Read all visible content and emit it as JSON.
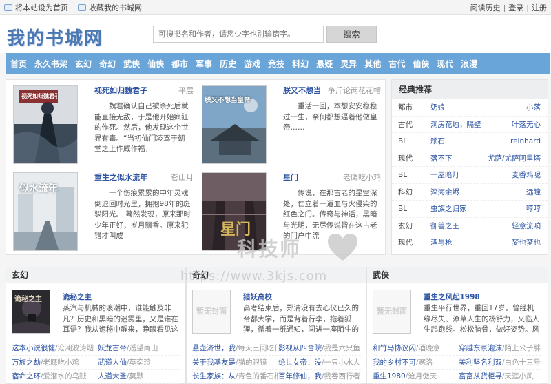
{
  "topbar": {
    "set_home": "将本站设为首页",
    "bookmark": "收藏我的书城网",
    "history": "阅读历史",
    "login": "登录",
    "register": "注册"
  },
  "logo": "我的书城网",
  "search": {
    "placeholder": "可搜书名和作者，请您少字也别输错字。",
    "button": "搜索"
  },
  "nav": [
    "首页",
    "永久书架",
    "玄幻",
    "奇幻",
    "武侠",
    "仙侠",
    "都市",
    "军事",
    "历史",
    "游戏",
    "竞技",
    "科幻",
    "悬疑",
    "灵异",
    "其他",
    "古代",
    "仙侠",
    "现代",
    "浪漫"
  ],
  "featured": [
    {
      "title": "视死如归魏君子",
      "author": "平层",
      "desc": "魏君确认自己被杀死后就能直接无敌，于是他开始疯狂的作死。然后，他发现这个世界有毒。“当初仙门凌驾于朝堂之上作威作福，"
    },
    {
      "title": "朕又不想当",
      "author": "争斤论两花花帽",
      "desc": "重活一回，本想安安稳稳过一生，奈何都想逼着他做皇帝……"
    },
    {
      "title": "重生之似水流年",
      "author": "苍山月",
      "desc": "一个伤痕累累的中年灵魂倒退回时光里，拥抱98年的斑驳阳光。 蓦然发现，原来那时少年正好，岁月飘香。原来犯错才叫成"
    },
    {
      "title": "星门",
      "author": "老鹰吃小鸡",
      "desc": "传说，在那古老的星空深处，伫立着一道血与火侵染的红色之门。传奇与神话，黑暗与光明，无尽传说皆在这古老的门户中流"
    }
  ],
  "covers": [
    "视死如归魏君子",
    "朕又不想当皇帝",
    "似水流年",
    "星门"
  ],
  "sidebar": {
    "title": "经典推荐",
    "rows": [
      {
        "cat": "都市",
        "book": "奶娘",
        "author": "小落"
      },
      {
        "cat": "古代",
        "book": "洞房花烛，隔壁",
        "author": "叶落无心"
      },
      {
        "cat": "BL",
        "book": "顽石",
        "author": "reinhard"
      },
      {
        "cat": "现代",
        "book": "落不下",
        "author": "尤萨/尤萨阿里塔"
      },
      {
        "cat": "BL",
        "book": "一屋暗灯",
        "author": "麦香鸡呢"
      },
      {
        "cat": "科幻",
        "book": "深海余烬",
        "author": "远瞳"
      },
      {
        "cat": "BL",
        "book": "虫族之归家",
        "author": "哼哼"
      },
      {
        "cat": "玄幻",
        "book": "御兽之王",
        "author": "轻意流响"
      },
      {
        "cat": "现代",
        "book": "酒与枪",
        "author": "梦也梦也"
      }
    ]
  },
  "genres": [
    {
      "name": "玄幻",
      "top_title": "诡秘之主",
      "top_desc": "蒸汽与机械的浪潮中，谁能触及非凡？历史和黑暗的迷雾里，又是谁在耳语？我从诡秘中醒来，睁眼看见这个世界：枪械，",
      "cover": "诡秘之主",
      "items": [
        {
          "l_name": "这本小说很健",
          "l_author": "/沧澜波涛烟",
          "r_name": "妖龙古帝",
          "r_author": "/遥望南山"
        },
        {
          "l_name": "万族之劫",
          "l_author": "/老鹰吃小鸡",
          "r_name": "武道人仙",
          "r_author": "/莫奕瑄"
        },
        {
          "l_name": "宿命之环",
          "l_author": "/爱潜水的乌贼",
          "r_name": "人道大圣",
          "r_author": "/莫默"
        }
      ]
    },
    {
      "name": "奇幻",
      "top_title": "猎妖高校",
      "top_desc": "高考结束后，郑清没有去心仪已久的帝都大学，而是背着行李，拖着狐狸，循着一纸通知，闯进一座陌生的高校。这里没有",
      "cover": "暂无封面",
      "items": [
        {
          "l_name": "悬壶济世，我",
          "l_author": "/每天三问吃什",
          "r_name": "影视从四合院",
          "r_author": "/我是六只鱼"
        },
        {
          "l_name": "关于我基友是",
          "l_author": "/猫的眼镜",
          "r_name": "绝世女帝：没",
          "r_author": "/一只小水人"
        },
        {
          "l_name": "长生家族：从",
          "l_author": "/青色的番石榴",
          "r_name": "百年修仙，我",
          "r_author": "/我吞西行者"
        }
      ]
    },
    {
      "name": "武侠",
      "top_title": "重生之风起1998",
      "top_desc": "重生平行世界，重回17岁。曾经机缘尽失、潦草人生的杨舒力，又临人生起跑线。松松脑骨，做好姿势。风来了，很清",
      "cover": "暂无封面",
      "items": [
        {
          "l_name": "和竹马协议闪",
          "l_author": "/酒晚意",
          "r_name": "穿越东京泡沫",
          "r_author": "/陌上公子胖"
        },
        {
          "l_name": "我的乡村不可",
          "l_author": "/寒洛",
          "r_name": "美利坚名利双",
          "r_author": "/白色十三号"
        },
        {
          "l_name": "重生1980",
          "l_author": "/沧月傲天",
          "r_name": "富富从货柜寻",
          "r_author": "/天涯小风"
        }
      ]
    }
  ],
  "watermark": {
    "text": "科技师",
    "url": "https://www.3kjs.com"
  }
}
